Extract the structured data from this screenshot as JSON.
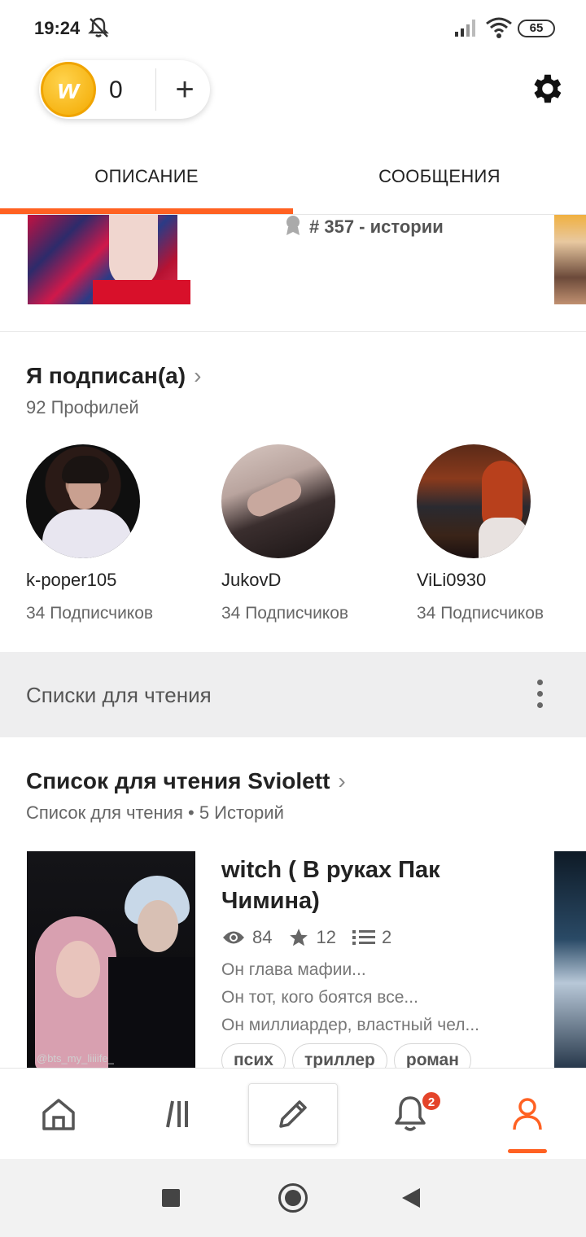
{
  "status_bar": {
    "time": "19:24",
    "battery": "65"
  },
  "coins": {
    "count": "0",
    "add_symbol": "+",
    "coin_letter": "w"
  },
  "tabs": [
    {
      "label": "ОПИСАНИЕ",
      "active": true
    },
    {
      "label": "СООБЩЕНИЯ",
      "active": false
    }
  ],
  "strip": {
    "rank": "# 357 - истории"
  },
  "following": {
    "title": "Я подписан(а)",
    "count": "92 Профилей",
    "profiles": [
      {
        "name": "k-poper105",
        "followers": "34 Подписчиков"
      },
      {
        "name": "JukovD",
        "followers": "34 Подписчиков"
      },
      {
        "name": "ViLi0930",
        "followers": "34 Подписчиков"
      }
    ]
  },
  "reading_lists": {
    "header": "Списки для чтения"
  },
  "reading_list": {
    "title": "Список для чтения Sviolett",
    "meta": "Список для чтения • 5 Историй",
    "story": {
      "title": "witch ( В руках Пак Чимина)",
      "reads": "84",
      "votes": "12",
      "parts": "2",
      "desc_lines": [
        "Он глава мафии...",
        "Он тот, кого боятся все...",
        "Он миллиардер, властный чел..."
      ],
      "tags": [
        "псих",
        "триллер",
        "роман"
      ],
      "cover_watermark": "@bts_my_liiiife_"
    }
  },
  "bottom_nav": {
    "items": [
      "home",
      "library",
      "write",
      "notifications",
      "profile"
    ],
    "notification_badge": "2",
    "accent": "#ff6122"
  },
  "colors": {
    "accent": "#ff6122",
    "badge": "#e4442a",
    "coin": "#f3a900"
  }
}
